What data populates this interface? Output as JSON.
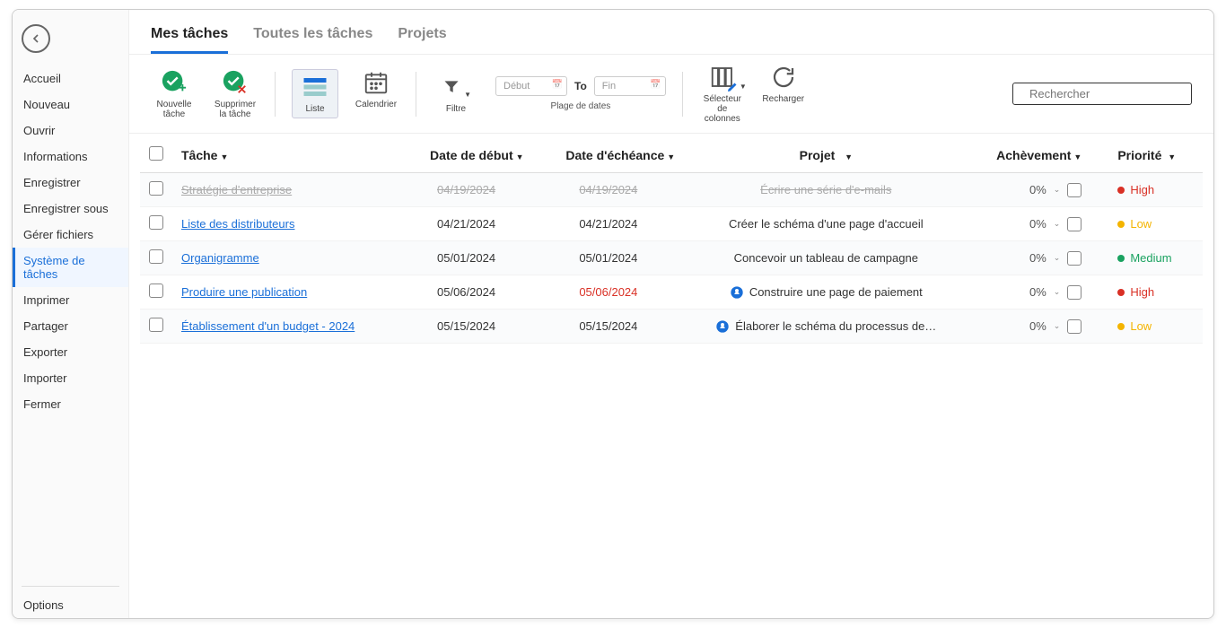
{
  "sidebar": {
    "items": [
      {
        "label": "Accueil"
      },
      {
        "label": "Nouveau"
      },
      {
        "label": "Ouvrir"
      },
      {
        "label": "Informations"
      },
      {
        "label": "Enregistrer"
      },
      {
        "label": "Enregistrer sous"
      },
      {
        "label": "Gérer fichiers"
      },
      {
        "label": "Système de tâches",
        "active": true
      },
      {
        "label": "Imprimer"
      },
      {
        "label": "Partager"
      },
      {
        "label": "Exporter"
      },
      {
        "label": "Importer"
      },
      {
        "label": "Fermer"
      }
    ],
    "options": "Options"
  },
  "tabs": [
    {
      "label": "Mes tâches",
      "active": true
    },
    {
      "label": "Toutes les tâches"
    },
    {
      "label": "Projets"
    }
  ],
  "toolbar": {
    "newTask": "Nouvelle\ntâche",
    "deleteTask": "Supprimer\nla tâche",
    "listView": "Liste",
    "calendarView": "Calendrier",
    "filter": "Filtre",
    "dateRange": {
      "label": "Plage de dates",
      "start": "Début",
      "to": "To",
      "end": "Fin"
    },
    "columnSelector": "Sélecteur\nde colonnes",
    "reload": "Recharger",
    "searchPlaceholder": "Rechercher"
  },
  "columns": {
    "task": "Tâche",
    "start": "Date de début",
    "due": "Date d'échéance",
    "project": "Projet",
    "completion": "Achèvement",
    "priority": "Priorité"
  },
  "rows": [
    {
      "task": "Stratégie d'entreprise",
      "start": "04/19/2024",
      "due": "04/19/2024",
      "project": "Écrire une série d'e-mails",
      "projectIcon": false,
      "completion": "0%",
      "priority": "High",
      "completed": true
    },
    {
      "task": "Liste des distributeurs",
      "start": "04/21/2024",
      "due": "04/21/2024",
      "project": "Créer le schéma d'une page d'accueil",
      "projectIcon": false,
      "completion": "0%",
      "priority": "Low"
    },
    {
      "task": "Organigramme",
      "start": "05/01/2024",
      "due": "05/01/2024",
      "project": "Concevoir un tableau de campagne",
      "projectIcon": false,
      "completion": "0%",
      "priority": "Medium"
    },
    {
      "task": "Produire une publication",
      "start": "05/06/2024",
      "due": "05/06/2024",
      "overdue": true,
      "project": "Construire une page de paiement",
      "projectIcon": true,
      "completion": "0%",
      "priority": "High"
    },
    {
      "task": "Établissement d'un budget - 2024",
      "start": "05/15/2024",
      "due": "05/15/2024",
      "project": "Élaborer le schéma du processus de…",
      "projectIcon": true,
      "completion": "0%",
      "priority": "Low"
    }
  ]
}
